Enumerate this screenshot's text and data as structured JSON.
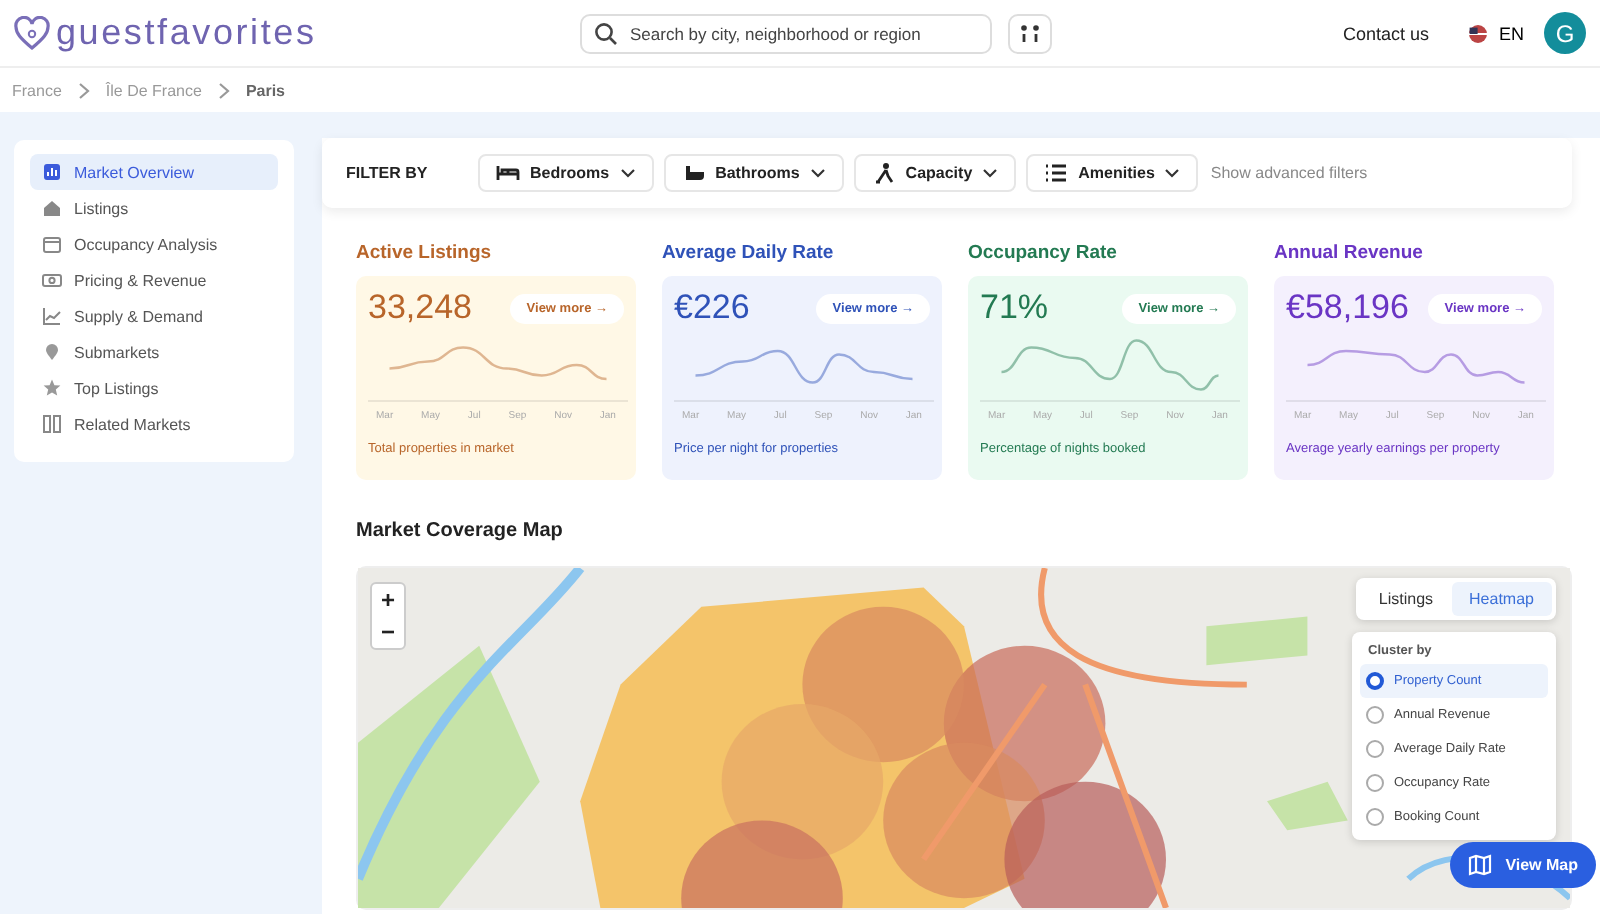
{
  "header": {
    "logo": "guestfavorites",
    "search": {
      "placeholder": "Search by city, neighborhood or region"
    },
    "contact": "Contact us",
    "language": "EN",
    "avatar": "G"
  },
  "breadcrumb": [
    {
      "label": "France",
      "current": false
    },
    {
      "label": "Île De France",
      "current": false
    },
    {
      "label": "Paris",
      "current": true
    }
  ],
  "sidebar": {
    "items": [
      {
        "label": "Market Overview",
        "selected": true
      },
      {
        "label": "Listings",
        "selected": false
      },
      {
        "label": "Occupancy Analysis",
        "selected": false
      },
      {
        "label": "Pricing & Revenue",
        "selected": false
      },
      {
        "label": "Supply & Demand",
        "selected": false
      },
      {
        "label": "Submarkets",
        "selected": false
      },
      {
        "label": "Top Listings",
        "selected": false
      },
      {
        "label": "Related Markets",
        "selected": false
      }
    ]
  },
  "filters": {
    "label": "FILTER BY",
    "items": [
      {
        "label": "Bedrooms"
      },
      {
        "label": "Bathrooms"
      },
      {
        "label": "Capacity"
      },
      {
        "label": "Amenities"
      }
    ],
    "advanced": "Show advanced filters"
  },
  "metrics": [
    {
      "title": "Active Listings",
      "value": "33,248",
      "link": "View more →",
      "caption": "Total properties in market",
      "color": "#b8652a",
      "months": [
        "Mar",
        "May",
        "Jul",
        "Sep",
        "Nov",
        "Jan"
      ]
    },
    {
      "title": "Average Daily Rate",
      "value": "€226",
      "link": "View more →",
      "caption": "Price per night for properties",
      "color": "#2f52b8",
      "months": [
        "Mar",
        "May",
        "Jul",
        "Sep",
        "Nov",
        "Jan"
      ]
    },
    {
      "title": "Occupancy Rate",
      "value": "71%",
      "link": "View more →",
      "caption": "Percentage of nights booked",
      "color": "#237a52",
      "months": [
        "Mar",
        "May",
        "Jul",
        "Sep",
        "Nov",
        "Jan"
      ]
    },
    {
      "title": "Annual Revenue",
      "value": "€58,196",
      "link": "View more →",
      "caption": "Average yearly earnings per property",
      "color": "#6a35c4",
      "months": [
        "Mar",
        "May",
        "Jul",
        "Sep",
        "Nov",
        "Jan"
      ]
    }
  ],
  "map": {
    "title": "Market Coverage Map",
    "zoom_in": "+",
    "zoom_out": "−",
    "view_tabs": [
      {
        "label": "Listings",
        "selected": false
      },
      {
        "label": "Heatmap",
        "selected": true
      }
    ],
    "cluster_label": "Cluster by",
    "cluster_options": [
      {
        "label": "Property Count",
        "selected": true
      },
      {
        "label": "Annual Revenue",
        "selected": false
      },
      {
        "label": "Average Daily Rate",
        "selected": false
      },
      {
        "label": "Occupancy Rate",
        "selected": false
      },
      {
        "label": "Booking Count",
        "selected": false
      }
    ],
    "view_button": "View Map"
  }
}
